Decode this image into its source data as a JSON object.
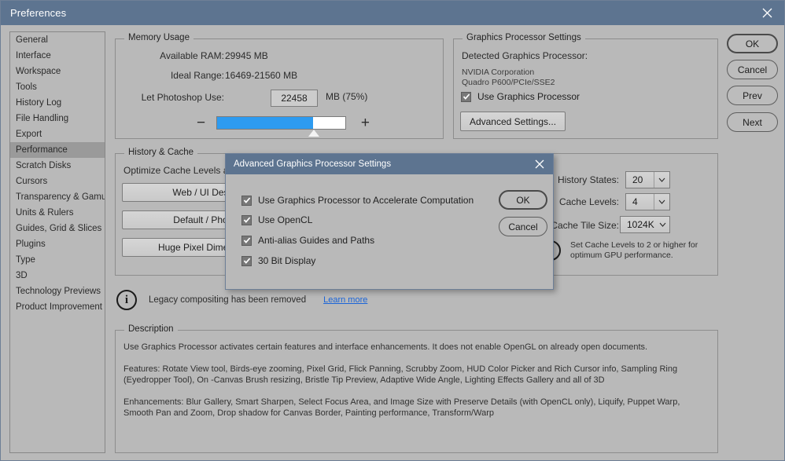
{
  "window": {
    "title": "Preferences",
    "close_icon": "close-icon"
  },
  "sidebar": {
    "items": [
      {
        "label": "General",
        "selected": false
      },
      {
        "label": "Interface",
        "selected": false
      },
      {
        "label": "Workspace",
        "selected": false
      },
      {
        "label": "Tools",
        "selected": false
      },
      {
        "label": "History Log",
        "selected": false
      },
      {
        "label": "File Handling",
        "selected": false
      },
      {
        "label": "Export",
        "selected": false
      },
      {
        "label": "Performance",
        "selected": true
      },
      {
        "label": "Scratch Disks",
        "selected": false
      },
      {
        "label": "Cursors",
        "selected": false
      },
      {
        "label": "Transparency & Gamut",
        "selected": false
      },
      {
        "label": "Units & Rulers",
        "selected": false
      },
      {
        "label": "Guides, Grid & Slices",
        "selected": false
      },
      {
        "label": "Plugins",
        "selected": false
      },
      {
        "label": "Type",
        "selected": false
      },
      {
        "label": "3D",
        "selected": false
      },
      {
        "label": "Technology Previews",
        "selected": false
      },
      {
        "label": "Product Improvement",
        "selected": false
      }
    ]
  },
  "memory": {
    "legend": "Memory Usage",
    "available_ram_label": "Available RAM:",
    "available_ram_value": "29945 MB",
    "ideal_range_label": "Ideal Range:",
    "ideal_range_value": "16469-21560 MB",
    "let_use_label": "Let Photoshop Use:",
    "let_use_value": "22458",
    "let_use_unit": "MB (75%)",
    "slider_percent": 75,
    "minus_label": "−",
    "plus_label": "+",
    "fill_color": "#2d9bf0"
  },
  "gpu": {
    "legend": "Graphics Processor Settings",
    "detected_label": "Detected Graphics Processor:",
    "vendor": "NVIDIA Corporation",
    "model": "Quadro P600/PCIe/SSE2",
    "use_gpu_label": "Use Graphics Processor",
    "use_gpu_checked": true,
    "advanced_button": "Advanced Settings..."
  },
  "history": {
    "legend": "History & Cache",
    "optimize_note": "Optimize Cache Levels and Tile Size for:",
    "presets": [
      "Web / UI Design",
      "Default / Photos",
      "Huge Pixel Dimensions"
    ],
    "fields": [
      {
        "label": "History States:",
        "value": "20"
      },
      {
        "label": "Cache Levels:",
        "value": "4"
      },
      {
        "label": "Cache Tile Size:",
        "value": "1024K"
      }
    ],
    "warning_line1": "Set Cache Levels to 2 or higher for",
    "warning_line2": "optimum GPU performance."
  },
  "legacy": {
    "info_icon": "info-icon",
    "text": "Legacy compositing has been removed",
    "link": "Learn more",
    "link_color": "#1a64d8"
  },
  "description": {
    "legend": "Description",
    "paragraphs": [
      "Use Graphics Processor activates certain features and interface enhancements. It does not enable OpenGL on already open documents.",
      "Features: Rotate View tool, Birds-eye zooming, Pixel Grid, Flick Panning, Scrubby Zoom, HUD Color Picker and Rich Cursor info, Sampling Ring (Eyedropper Tool), On -Canvas Brush resizing, Bristle Tip Preview, Adaptive Wide Angle, Lighting Effects Gallery and all of 3D",
      "Enhancements: Blur Gallery, Smart Sharpen, Select Focus Area, and Image Size with Preserve Details (with OpenCL only), Liquify, Puppet Warp, Smooth Pan and Zoom, Drop shadow for Canvas Border, Painting performance, Transform/Warp"
    ]
  },
  "actions": [
    {
      "label": "OK",
      "primary": true
    },
    {
      "label": "Cancel",
      "primary": false
    },
    {
      "label": "Prev",
      "primary": false
    },
    {
      "label": "Next",
      "primary": false
    }
  ],
  "modal": {
    "title": "Advanced Graphics Processor Settings",
    "close_icon": "close-icon",
    "checkboxes": [
      {
        "label": "Use Graphics Processor to Accelerate Computation",
        "checked": true
      },
      {
        "label": "Use OpenCL",
        "checked": true
      },
      {
        "label": "Anti-alias Guides and Paths",
        "checked": true
      },
      {
        "label": "30 Bit Display",
        "checked": true
      }
    ],
    "buttons": [
      {
        "label": "OK",
        "primary": true
      },
      {
        "label": "Cancel",
        "primary": false
      }
    ]
  }
}
